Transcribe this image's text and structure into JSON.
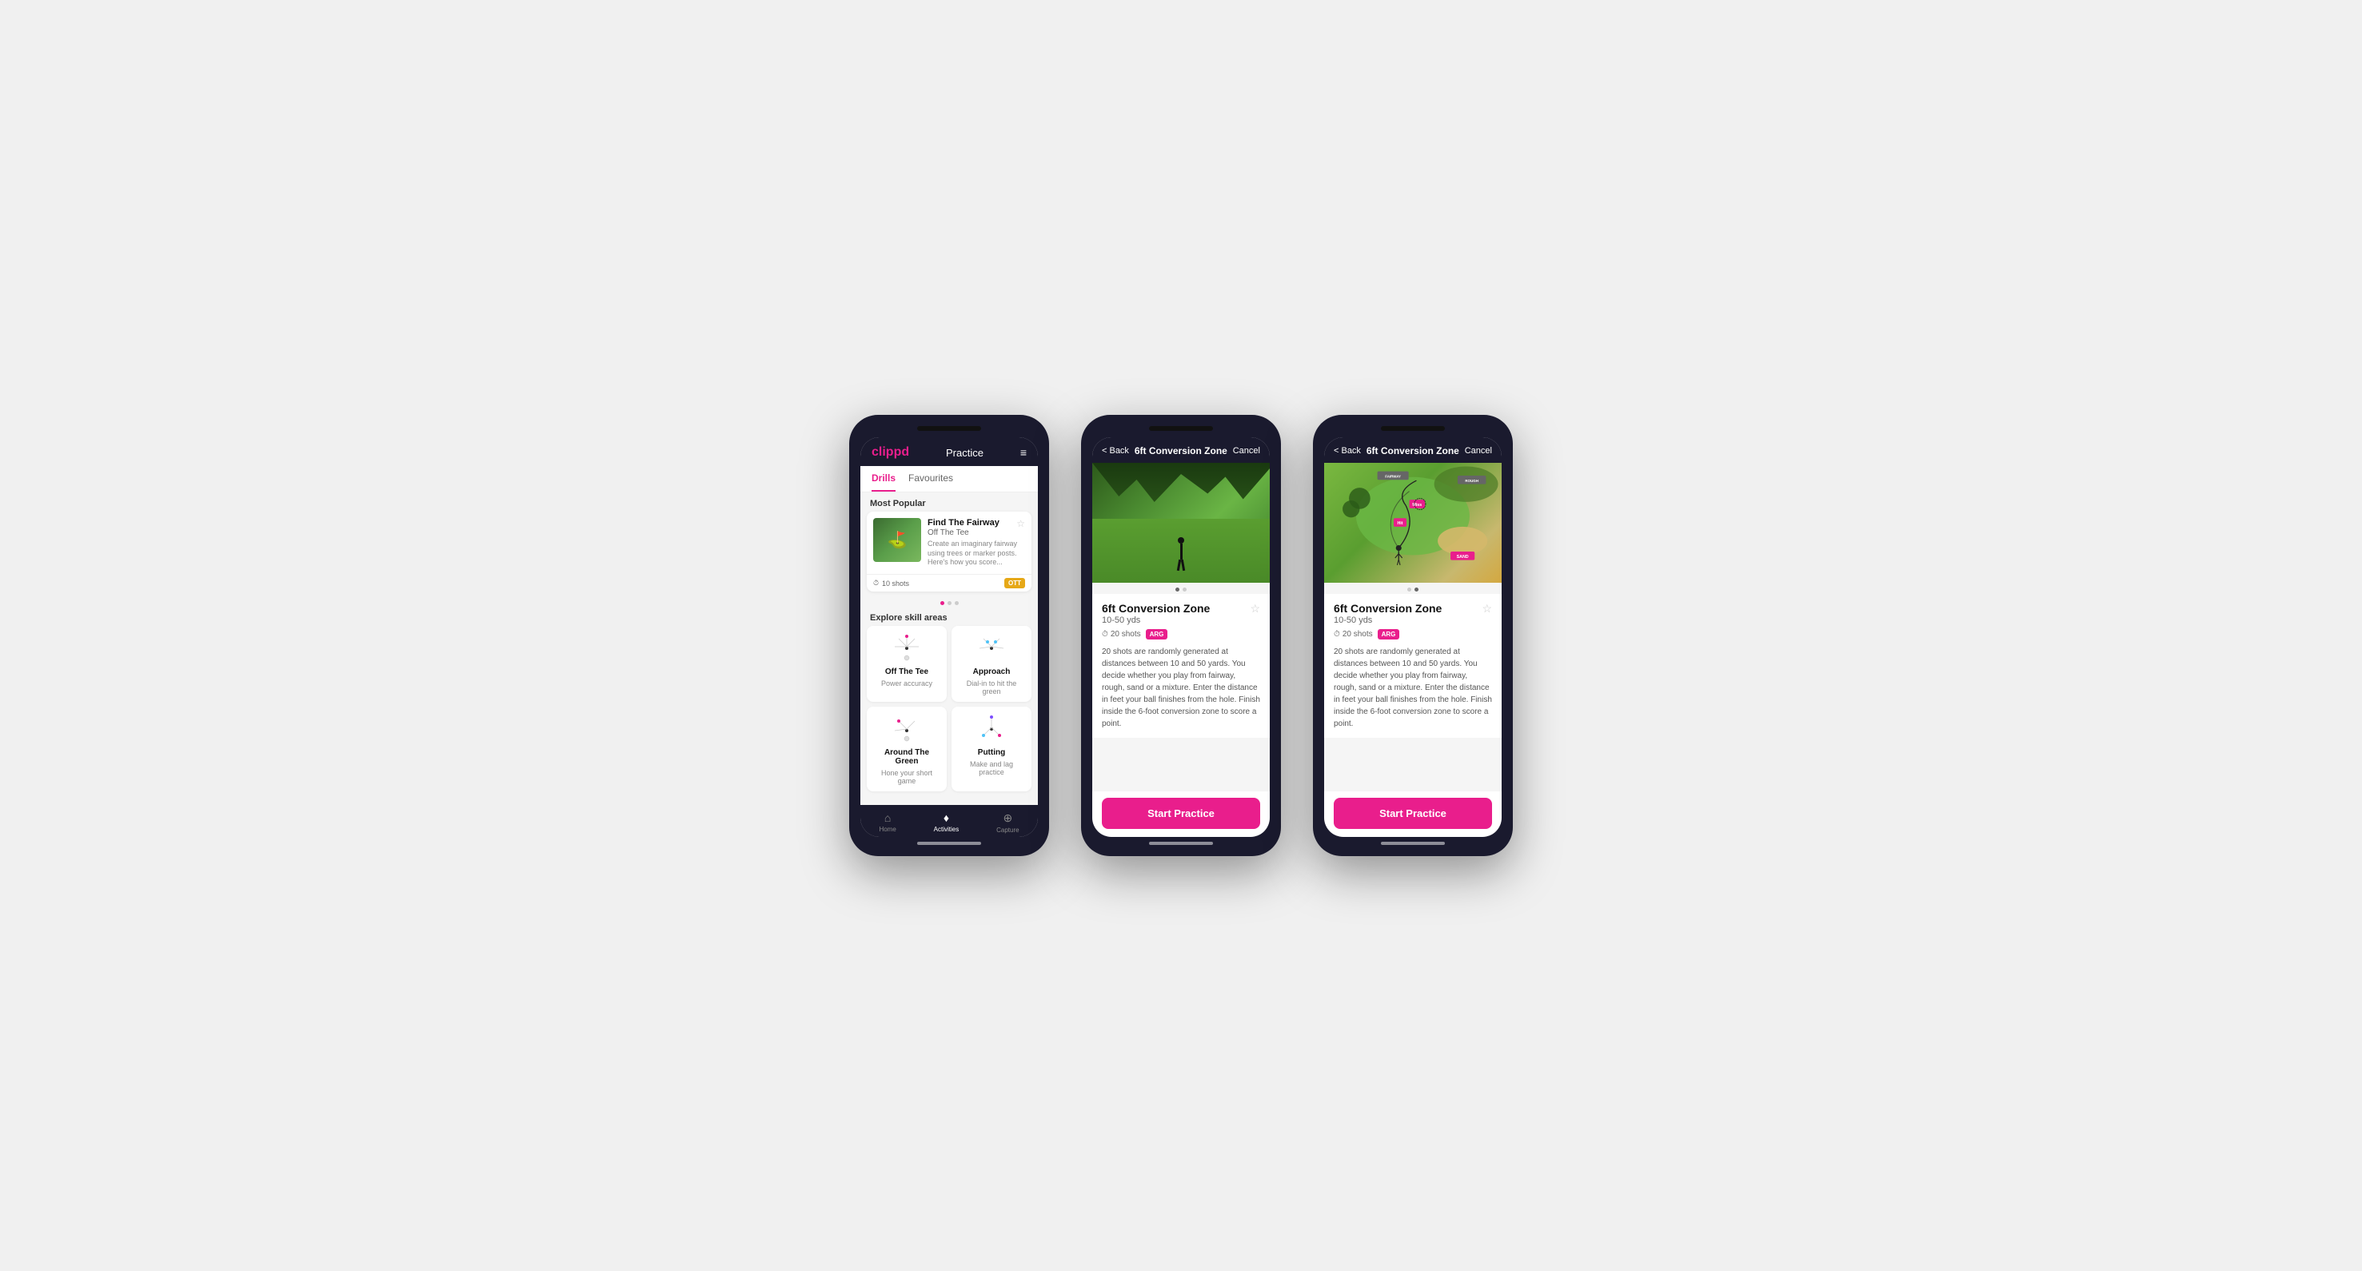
{
  "phone1": {
    "header": {
      "logo": "clippd",
      "title": "Practice",
      "menu_icon": "≡"
    },
    "tabs": [
      {
        "label": "Drills",
        "active": true
      },
      {
        "label": "Favourites",
        "active": false
      }
    ],
    "most_popular_label": "Most Popular",
    "featured_card": {
      "title": "Find The Fairway",
      "subtitle": "Off The Tee",
      "description": "Create an imaginary fairway using trees or marker posts. Here's how you score...",
      "shots": "10 shots",
      "badge": "OTT"
    },
    "explore_label": "Explore skill areas",
    "skill_areas": [
      {
        "name": "Off The Tee",
        "desc": "Power accuracy"
      },
      {
        "name": "Approach",
        "desc": "Dial-in to hit the green"
      },
      {
        "name": "Around The Green",
        "desc": "Hone your short game"
      },
      {
        "name": "Putting",
        "desc": "Make and lag practice"
      }
    ],
    "bottom_nav": [
      {
        "label": "Home",
        "active": false,
        "icon": "⌂"
      },
      {
        "label": "Activities",
        "active": true,
        "icon": "♦"
      },
      {
        "label": "Capture",
        "active": false,
        "icon": "⊕"
      }
    ]
  },
  "phone2": {
    "header": {
      "back_label": "< Back",
      "title": "6ft Conversion Zone",
      "cancel_label": "Cancel"
    },
    "drill": {
      "title": "6ft Conversion Zone",
      "range": "10-50 yds",
      "shots": "20 shots",
      "badge": "ARG",
      "description": "20 shots are randomly generated at distances between 10 and 50 yards. You decide whether you play from fairway, rough, sand or a mixture. Enter the distance in feet your ball finishes from the hole. Finish inside the 6-foot conversion zone to score a point.",
      "start_btn": "Start Practice"
    }
  },
  "phone3": {
    "header": {
      "back_label": "< Back",
      "title": "6ft Conversion Zone",
      "cancel_label": "Cancel"
    },
    "drill": {
      "title": "6ft Conversion Zone",
      "range": "10-50 yds",
      "shots": "20 shots",
      "badge": "ARG",
      "description": "20 shots are randomly generated at distances between 10 and 50 yards. You decide whether you play from fairway, rough, sand or a mixture. Enter the distance in feet your ball finishes from the hole. Finish inside the 6-foot conversion zone to score a point.",
      "start_btn": "Start Practice"
    }
  }
}
